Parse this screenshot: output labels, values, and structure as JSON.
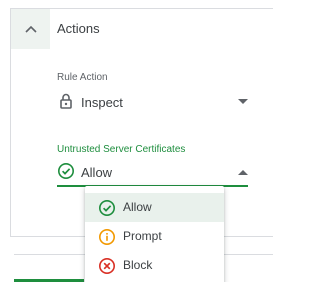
{
  "colors": {
    "accent": "#1e8e3e",
    "prompt": "#f29900",
    "block": "#d93025",
    "text": "#3c4043",
    "muted": "#5f6368"
  },
  "section": {
    "title": "Actions",
    "toggle_icon": "chevron-up-icon"
  },
  "rule_action": {
    "label": "Rule Action",
    "value": "Inspect",
    "icon": "lock-icon"
  },
  "untrusted_certs": {
    "label": "Untrusted Server Certificates",
    "value": "Allow",
    "icon": "check-circle-icon",
    "options": [
      {
        "label": "Allow",
        "icon": "check-circle-icon",
        "selected": true
      },
      {
        "label": "Prompt",
        "icon": "info-circle-icon",
        "selected": false
      },
      {
        "label": "Block",
        "icon": "x-circle-icon",
        "selected": false
      }
    ]
  }
}
